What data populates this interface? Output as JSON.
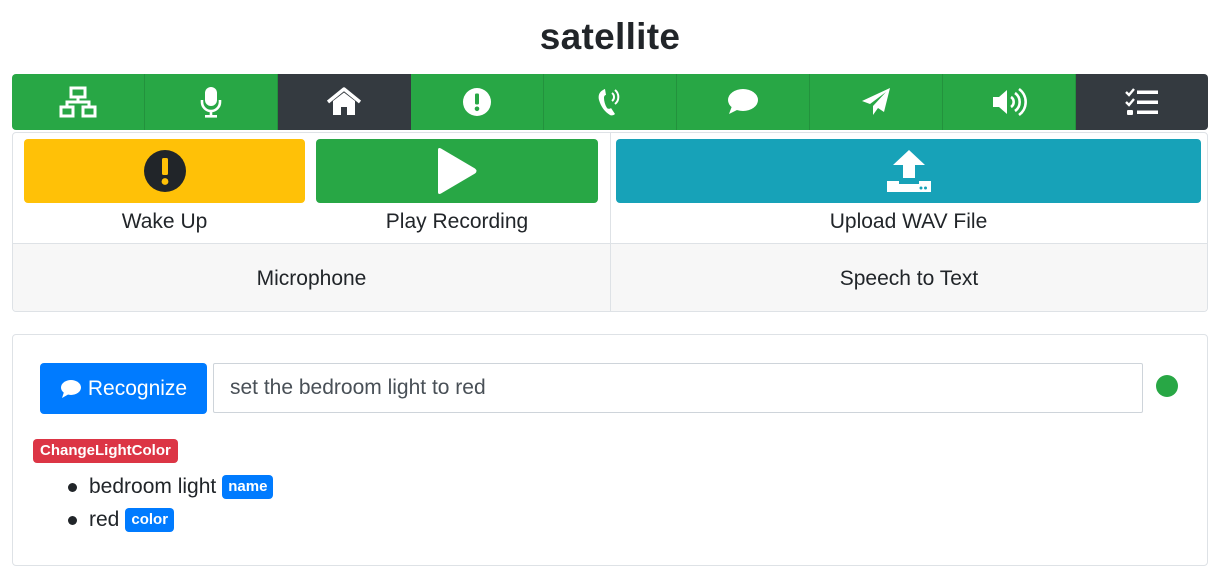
{
  "header": {
    "title": "satellite"
  },
  "nav": {
    "items": [
      {
        "icon": "network-icon",
        "active": false
      },
      {
        "icon": "microphone-icon",
        "active": false
      },
      {
        "icon": "home-icon",
        "active": true
      },
      {
        "icon": "exclamation-circle-icon",
        "active": false
      },
      {
        "icon": "phone-volume-icon",
        "active": false
      },
      {
        "icon": "comment-icon",
        "active": false
      },
      {
        "icon": "paper-plane-icon",
        "active": false
      },
      {
        "icon": "volume-up-icon",
        "active": false
      },
      {
        "icon": "tasks-icon",
        "active": true
      }
    ]
  },
  "actions": {
    "wake_up": {
      "label": "Wake Up",
      "icon": "exclamation-circle-icon",
      "color": "#ffc107"
    },
    "play_recording": {
      "label": "Play Recording",
      "icon": "play-icon",
      "color": "#28a745"
    },
    "upload_wav": {
      "label": "Upload WAV File",
      "icon": "upload-icon",
      "color": "#17a2b8"
    },
    "microphone_label": "Microphone",
    "speech_to_text_label": "Speech to Text"
  },
  "recognize": {
    "button_label": "Recognize",
    "icon": "comment-icon",
    "input_value": "set the bedroom light to red",
    "status_color": "#28a745"
  },
  "result": {
    "intent": "ChangeLightColor",
    "entities": [
      {
        "value": "bedroom light",
        "entity": "name"
      },
      {
        "value": "red",
        "entity": "color"
      }
    ]
  },
  "colors": {
    "success": "#28a745",
    "dark": "#343a40",
    "primary": "#007bff",
    "danger": "#dc3545",
    "warning": "#ffc107",
    "info": "#17a2b8"
  }
}
